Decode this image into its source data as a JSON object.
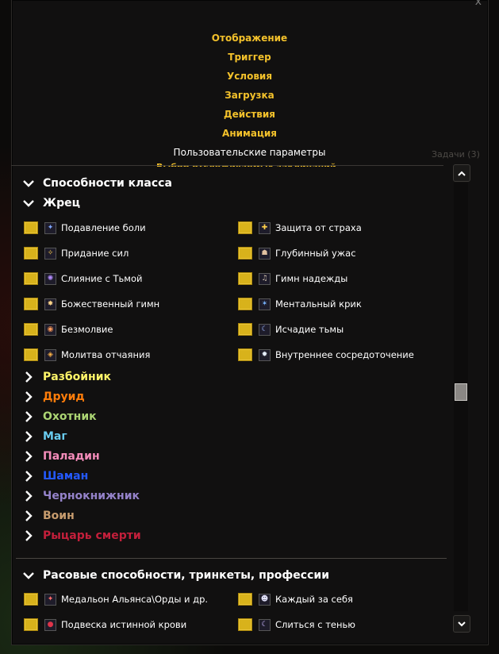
{
  "window": {
    "close_glyph": "x",
    "menu": [
      {
        "label": "Отображение"
      },
      {
        "label": "Триггер"
      },
      {
        "label": "Условия"
      },
      {
        "label": "Загрузка"
      },
      {
        "label": "Действия"
      },
      {
        "label": "Анимация"
      },
      {
        "label": "Пользовательские параметры"
      }
    ],
    "tasks_label": "Задачи (3)",
    "clipped_title": "Выбор отслеживаемых заклинаний"
  },
  "colors": {
    "accent_gold": "#f3c12b",
    "checkbox": "#d8b21b"
  },
  "sections": {
    "class_abilities": {
      "label": "Способности класса",
      "icon": "chevron-down-icon"
    },
    "priest": {
      "label": "Жрец",
      "icon": "chevron-down-icon",
      "spells_left": [
        {
          "name": "Подавление боли",
          "icon": "pain-suppression-icon",
          "glyph": "✦",
          "color": "#7fa7ff"
        },
        {
          "name": "Придание сил",
          "icon": "power-infusion-icon",
          "glyph": "✧",
          "color": "#ffd04a"
        },
        {
          "name": "Слияние с Тьмой",
          "icon": "dispersion-icon",
          "glyph": "✺",
          "color": "#b48cff"
        },
        {
          "name": "Божественный гимн",
          "icon": "divine-hymn-icon",
          "glyph": "✸",
          "color": "#ffd58a"
        },
        {
          "name": "Безмолвие",
          "icon": "silence-icon",
          "glyph": "◉",
          "color": "#ff9a5a"
        },
        {
          "name": "Молитва отчаяния",
          "icon": "desperate-prayer-icon",
          "glyph": "◈",
          "color": "#ffb347"
        }
      ],
      "spells_right": [
        {
          "name": "Защита от страха",
          "icon": "fear-ward-icon",
          "glyph": "✚",
          "color": "#ffcf4a"
        },
        {
          "name": "Глубинный ужас",
          "icon": "psychic-horror-icon",
          "glyph": "☗",
          "color": "#e0c0a0"
        },
        {
          "name": "Гимн надежды",
          "icon": "hymn-of-hope-icon",
          "glyph": "♫",
          "color": "#d6c6b0"
        },
        {
          "name": "Ментальный крик",
          "icon": "psychic-scream-icon",
          "glyph": "✶",
          "color": "#79b4ff"
        },
        {
          "name": "Исчадие тьмы",
          "icon": "shadowfiend-icon",
          "glyph": "☾",
          "color": "#9db8ff"
        },
        {
          "name": "Внутреннее сосредоточение",
          "icon": "inner-focus-icon",
          "glyph": "✹",
          "color": "#e8f0ff"
        }
      ]
    },
    "classes": [
      {
        "label": "Разбойник",
        "color": "#fff569"
      },
      {
        "label": "Друид",
        "color": "#ff7d0a"
      },
      {
        "label": "Охотник",
        "color": "#abd473"
      },
      {
        "label": "Маг",
        "color": "#69ccf0"
      },
      {
        "label": "Паладин",
        "color": "#f58cba"
      },
      {
        "label": "Шаман",
        "color": "#2459ff"
      },
      {
        "label": "Чернокнижник",
        "color": "#9482c9"
      },
      {
        "label": "Воин",
        "color": "#c79c6e"
      },
      {
        "label": "Рыцарь смерти",
        "color": "#c41f3b"
      }
    ],
    "racial": {
      "label": "Расовые способности, тринкеты, профессии",
      "icon": "chevron-down-icon",
      "items_left": [
        {
          "name": "Медальон Альянса\\Орды и др.",
          "icon": "medallion-icon",
          "glyph": "✦",
          "color": "#ff6a6a"
        },
        {
          "name": "Подвеска истинной крови",
          "icon": "blood-pendant-icon",
          "glyph": "●",
          "color": "#e0344a"
        }
      ],
      "items_right": [
        {
          "name": "Каждый за себя",
          "icon": "every-man-icon",
          "glyph": "☻",
          "color": "#e6e6ff"
        },
        {
          "name": "Слиться с тенью",
          "icon": "shadowmeld-icon",
          "glyph": "☾",
          "color": "#c9b5ff"
        }
      ]
    }
  }
}
